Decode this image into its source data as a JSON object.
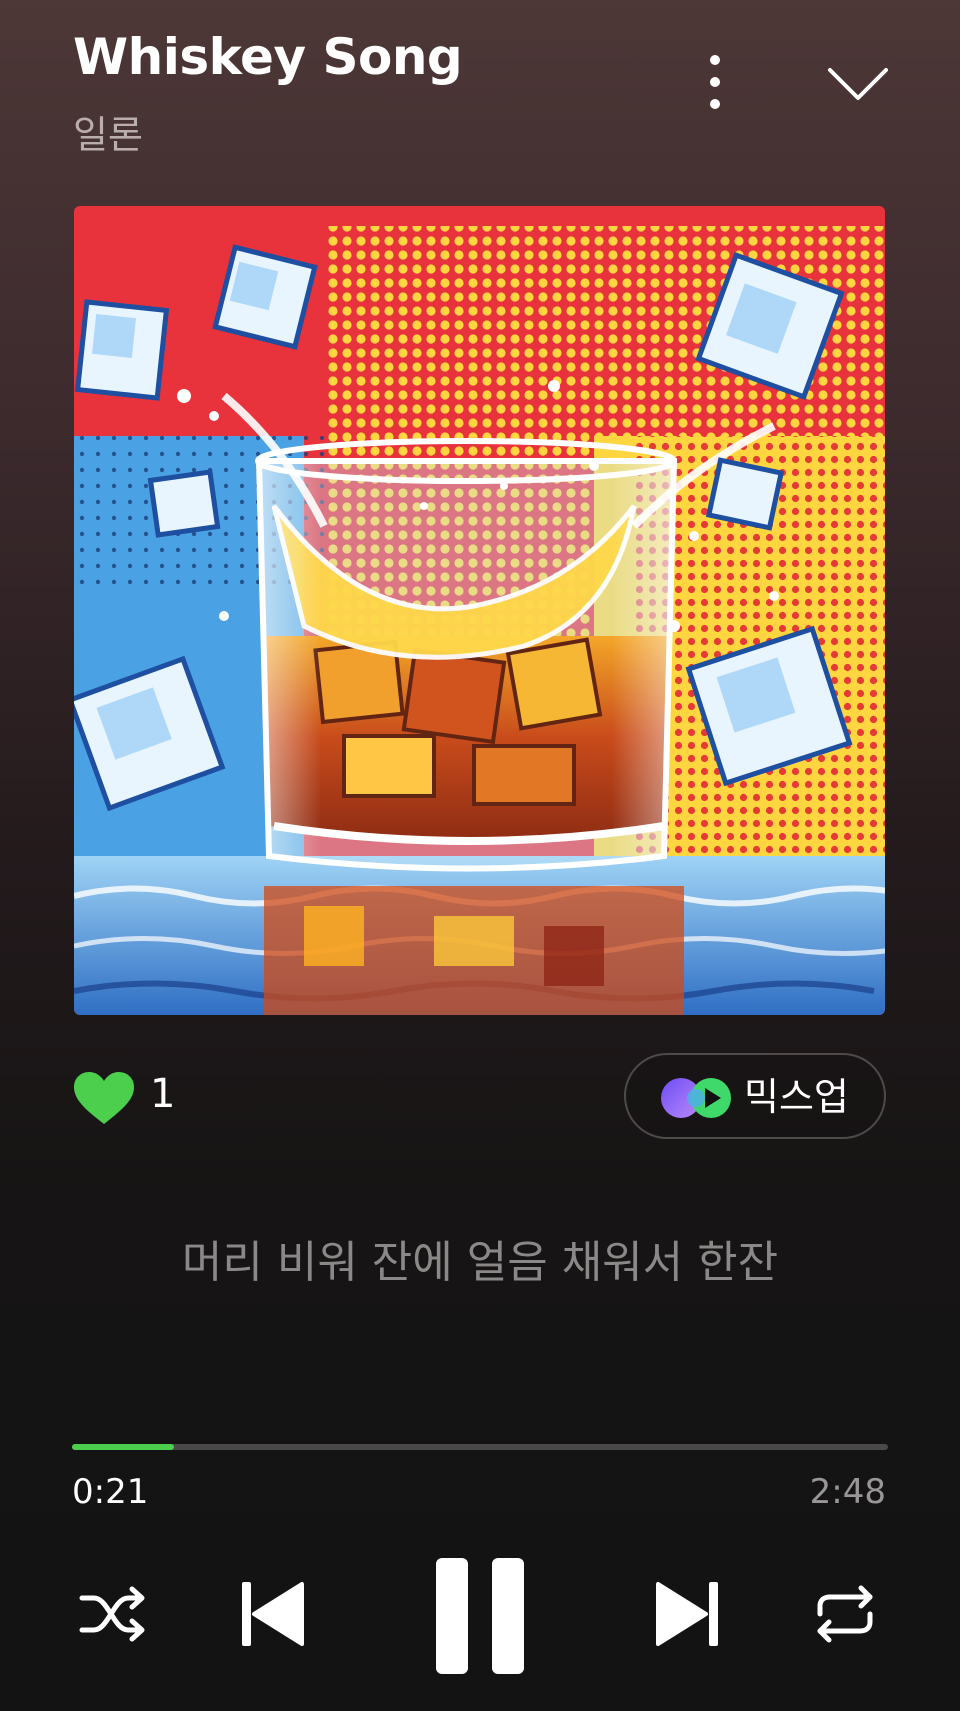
{
  "track": {
    "title": "Whiskey Song",
    "artist": "일론",
    "like_count": "1",
    "liked": true
  },
  "mixup": {
    "label": "믹스업"
  },
  "lyrics": {
    "current_line": "머리 비워 잔에 얼음 채워서 한잔"
  },
  "playback": {
    "elapsed": "0:21",
    "total": "2:48",
    "progress_fraction": 0.125,
    "state": "playing"
  },
  "icons": {
    "more": "more-vertical-icon",
    "collapse": "chevron-down-icon",
    "like": "heart-icon",
    "mixup": "mixup-icon",
    "shuffle": "shuffle-icon",
    "previous": "skip-previous-icon",
    "pause": "pause-icon",
    "next": "skip-next-icon",
    "repeat": "repeat-icon"
  },
  "colors": {
    "accent": "#4ccf4c",
    "heart": "#4ccf4c",
    "mixup_purple": "#8a5cf6",
    "mixup_green": "#3ed96a"
  }
}
